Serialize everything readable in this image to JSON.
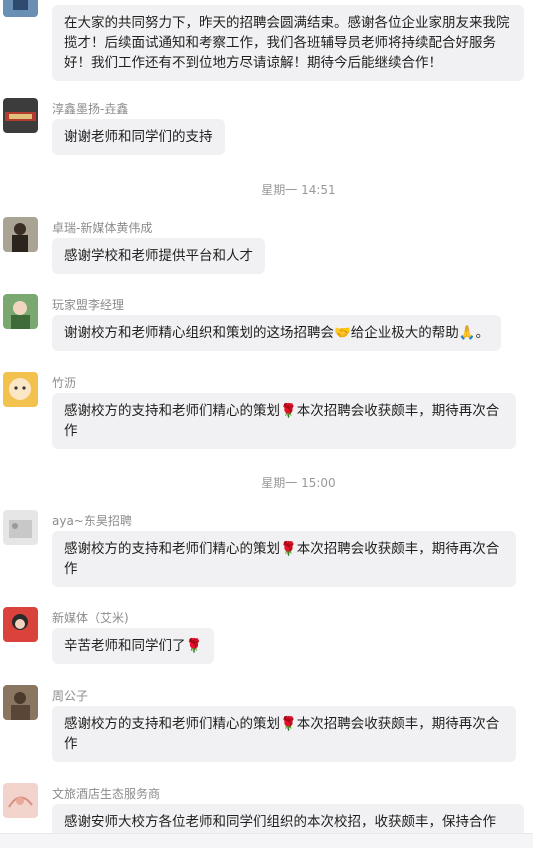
{
  "messages": [
    {
      "sender": "",
      "text": "在大家的共同努力下，昨天的招聘会圆满结束。感谢各位企业家朋友来我院揽才！后续面试通知和考察工作，我们各班辅导员老师将持续配合好服务好！我们工作还有不到位地方尽请谅解！期待今后能继续合作！"
    },
    {
      "sender": "淳鑫墨扬-垚鑫",
      "text": "谢谢老师和同学们的支持"
    },
    {
      "sender": "卓瑞-新媒体黄伟成",
      "text": "感谢学校和老师提供平台和人才"
    },
    {
      "sender": "玩家盟李经理",
      "text": "谢谢校方和老师精心组织和策划的这场招聘会🤝给企业极大的帮助🙏。"
    },
    {
      "sender": "竹沥",
      "text": "感谢校方的支持和老师们精心的策划🌹本次招聘会收获颇丰，期待再次合作"
    },
    {
      "sender": "aya~东昊招聘",
      "text": "感谢校方的支持和老师们精心的策划🌹本次招聘会收获颇丰，期待再次合作"
    },
    {
      "sender": "新媒体（艾米)",
      "text": "辛苦老师和同学们了🌹"
    },
    {
      "sender": "周公子",
      "text": "感谢校方的支持和老师们精心的策划🌹本次招聘会收获颇丰，期待再次合作"
    },
    {
      "sender": "文旅酒店生态服务商",
      "text": "感谢安师大校方各位老师和同学们组织的本次校招，收获颇丰，保持合作"
    }
  ],
  "timestamps": [
    "星期一 14:51",
    "星期一 15:00"
  ],
  "avatar_colors": [
    "#6a8fb5",
    "#b23a2f",
    "#5b4a3a",
    "#7aa870",
    "#f2c14e",
    "#c8c8c8",
    "#d9433b",
    "#6b5644",
    "#f2d4cc"
  ]
}
